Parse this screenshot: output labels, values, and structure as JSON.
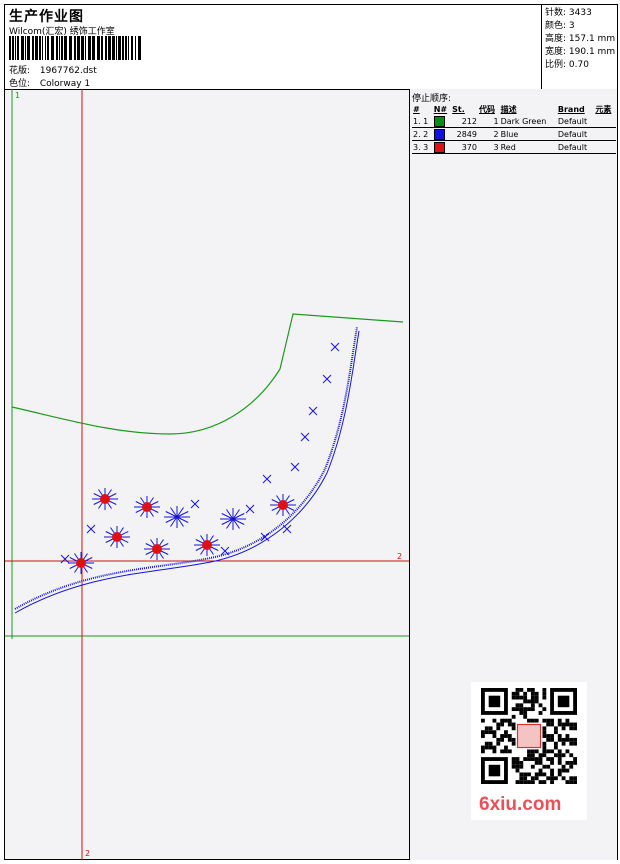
{
  "header": {
    "title": "生产作业图",
    "company": "Wilcom(汇宏) 绣饰工作室",
    "design_label": "花版:",
    "design_value": "1967762.dst",
    "colorway_label": "色位:",
    "colorway_value": "Colorway 1"
  },
  "stats": [
    {
      "label": "针数:",
      "value": "3433"
    },
    {
      "label": "颜色:",
      "value": "3"
    },
    {
      "label": "高度:",
      "value": "157.1 mm"
    },
    {
      "label": "宽度:",
      "value": "190.1 mm"
    },
    {
      "label": "比例:",
      "value": "0.70"
    }
  ],
  "stop_sequence": {
    "title": "停止顺序:",
    "columns": [
      "#",
      "N#",
      "St.",
      "代码",
      "描述",
      "Brand",
      "元素"
    ],
    "rows": [
      {
        "idx": "1. 1",
        "color": "#0a8a1a",
        "stitches": "212",
        "code": "1",
        "desc": "Dark Green",
        "brand": "Default"
      },
      {
        "idx": "2. 2",
        "color": "#1010e0",
        "stitches": "2849",
        "code": "2",
        "desc": "Blue",
        "brand": "Default"
      },
      {
        "idx": "3. 3",
        "color": "#e01010",
        "stitches": "370",
        "code": "3",
        "desc": "Red",
        "brand": "Default"
      }
    ]
  },
  "markers": {
    "one": "1",
    "two_right": "2",
    "two_bottom": "2"
  },
  "watermark": {
    "text": "6xiu.com",
    "stamp": "汉印"
  }
}
